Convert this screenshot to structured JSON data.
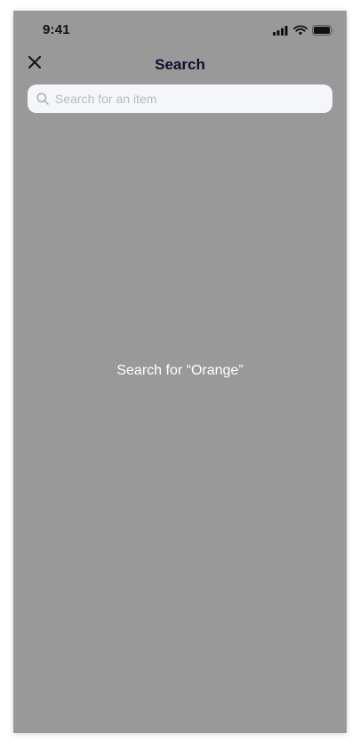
{
  "status_bar": {
    "time": "9:41",
    "icons": [
      "signal-icon",
      "wifi-icon",
      "battery-icon"
    ]
  },
  "nav": {
    "title": "Search",
    "close_icon": "close-icon"
  },
  "search": {
    "placeholder": "Search for an item",
    "value": "",
    "icon": "search-icon"
  },
  "suggestion": {
    "text": "Search for “Orange”"
  },
  "colors": {
    "background": "#999999",
    "title": "#0e0e2c",
    "search_field": "#f5f6f9",
    "placeholder": "#b8bac4",
    "suggestion_text": "#ffffff"
  }
}
